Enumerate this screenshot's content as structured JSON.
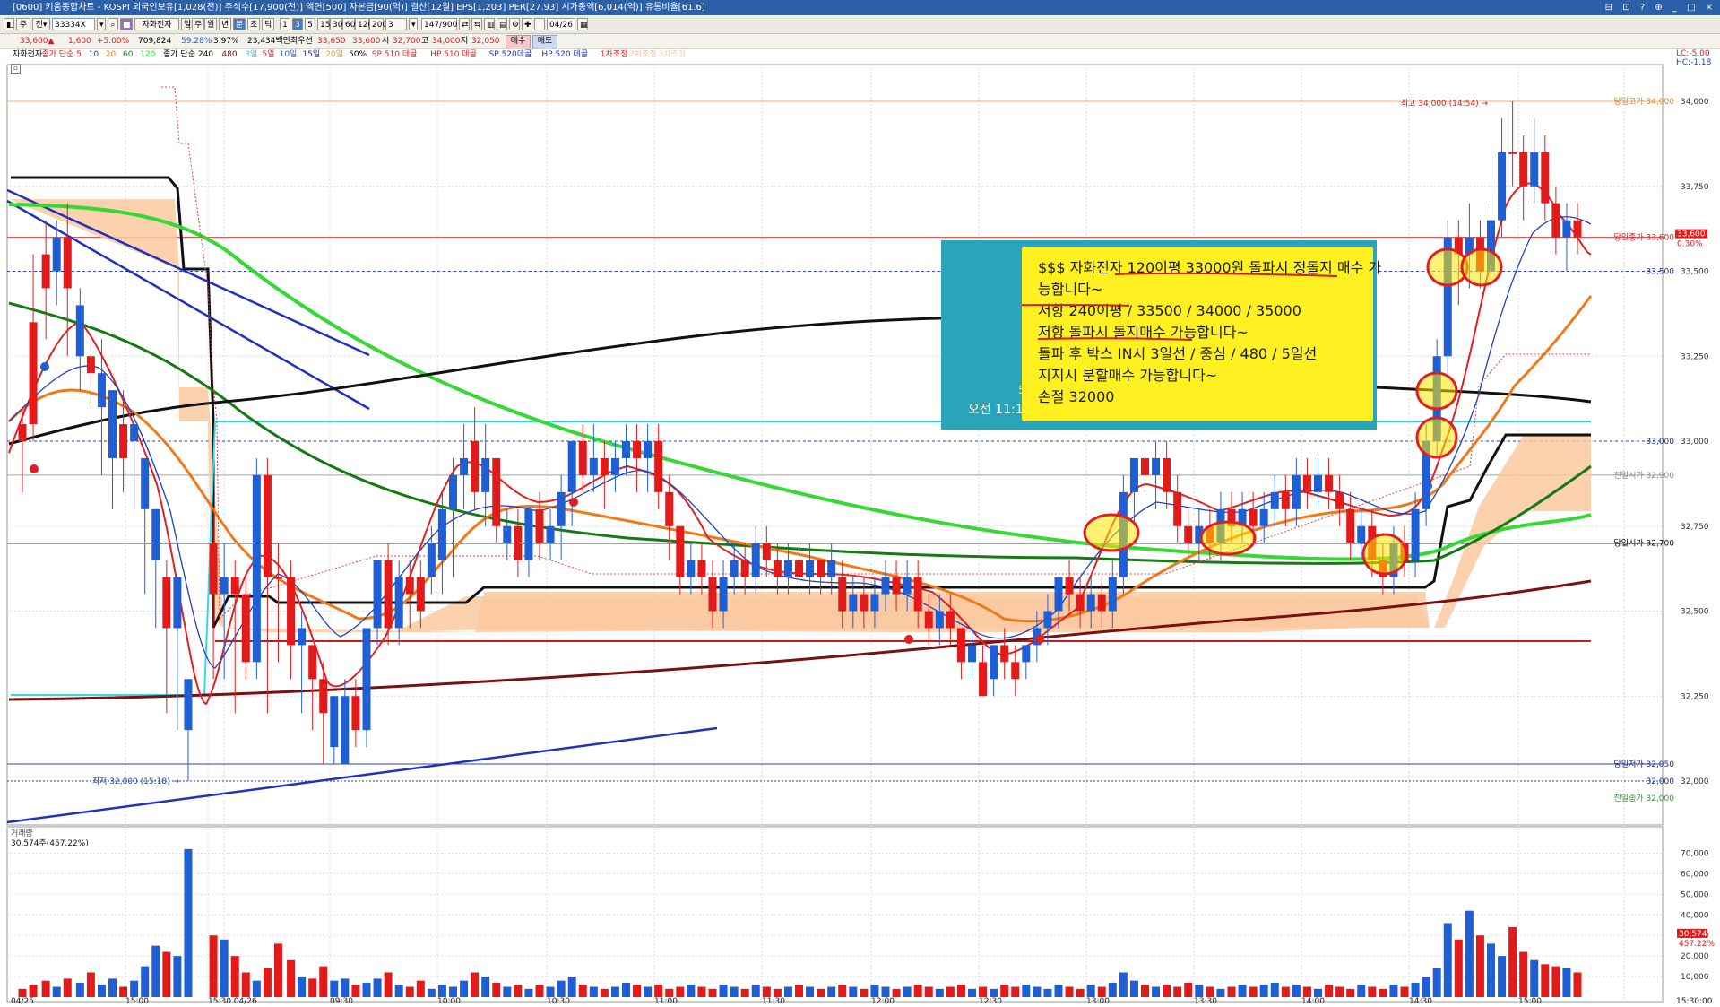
{
  "title_bar": {
    "text": "[0600] 키움종합차트 - KOSPI 외국인보유[1,028(천)] 주식수[17,900(천)] 액면[500] 자본금[90(억)] 결산[12월] EPS[1,203] PER[27.93] 시가총액[6,014(억)] 유통비율[61.6]",
    "controls": "⊟ ⊡ ? ⊕ _ □ ×"
  },
  "toolbar": {
    "code_value": "33334X",
    "stock_name": "자화전자",
    "period_buttons": [
      "일",
      "주",
      "월",
      "년",
      "분",
      "초",
      "틱"
    ],
    "minute_buttons": [
      "1",
      "3",
      "5",
      "15",
      "30",
      "60",
      "120",
      "200"
    ],
    "count": "3",
    "view_count": "147/900",
    "date": "04/26"
  },
  "quote": {
    "price": "33,600▲",
    "change": "1,600",
    "change_pct": "+5.00%",
    "volume": "709,824",
    "ratio": "59.28%",
    "pct2": "3.97%",
    "amount": "23,434백만",
    "best_ask_label": "최우선",
    "best_ask": "33,650",
    "best_bid": "33,600",
    "open_label": "시",
    "open": "32,700",
    "high_label": "고",
    "high": "34,000",
    "low_label": "저",
    "low": "32,050",
    "buy_button": "매수",
    "sell_button": "매도"
  },
  "legend": {
    "items": [
      {
        "text": "자화전자",
        "color": "#000000"
      },
      {
        "text": "종가 단순 5",
        "color": "#e02020"
      },
      {
        "text": "10",
        "color": "#1e3fbf"
      },
      {
        "text": "20",
        "color": "#f07a1a"
      },
      {
        "text": "60",
        "color": "#1a7a1a"
      },
      {
        "text": "120",
        "color": "#2ad42a"
      },
      {
        "text": "종가 단순 240",
        "color": "#000000"
      },
      {
        "text": "480",
        "color": "#7a1010"
      },
      {
        "text": "3일",
        "color": "#40c0d0"
      },
      {
        "text": "5일",
        "color": "#c03030"
      },
      {
        "text": "10일",
        "color": "#3060c0"
      },
      {
        "text": "15일",
        "color": "#303090"
      },
      {
        "text": "20일",
        "color": "#e0a040"
      },
      {
        "text": "50%",
        "color": "#000000"
      },
      {
        "text": "SP 510 데골",
        "color": "#e02020"
      },
      {
        "text": "HP 510 데골",
        "color": "#e02020"
      },
      {
        "text": "SP 520데골",
        "color": "#2030c0"
      },
      {
        "text": "HP 520 데골",
        "color": "#2030c0"
      },
      {
        "text": "1차조정",
        "color": "#e02020"
      },
      {
        "text": "2차조정",
        "color": "#f0c0a0"
      },
      {
        "text": "3차조정",
        "color": "#f0d0b0"
      }
    ],
    "corner_right": "LC:-5.00",
    "corner_right2": "HC:-1.18"
  },
  "price_axis": {
    "ticks": [
      "34,000",
      "33,750",
      "33,500",
      "33,250",
      "33,000",
      "32,750",
      "32,500",
      "32,250",
      "32,000"
    ],
    "labels": [
      {
        "text": "당일고가 34,000",
        "color": "#e08030"
      },
      {
        "text": "당일종가 33,600",
        "color": "#e02020"
      },
      {
        "text": "33,500",
        "color": "#1a2a9a"
      },
      {
        "text": "33,000",
        "color": "#1a2a9a"
      },
      {
        "text": "전일시가 32,900",
        "color": "#888888"
      },
      {
        "text": "당일시가 32,700",
        "color": "#000000"
      },
      {
        "text": "당일저가 32,050",
        "color": "#1a2a9a"
      },
      {
        "text": "32,000",
        "color": "#1a2a9a"
      },
      {
        "text": "전일종가 32,000",
        "color": "#2a9a2a"
      }
    ],
    "current_badge": "33,600",
    "current_badge2": "0.30%"
  },
  "time_axis": [
    "04/25",
    "15:00",
    "15:30 04/26",
    "09:30",
    "10:00",
    "10:30",
    "11:00",
    "11:30",
    "12:00",
    "12:30",
    "13:00",
    "13:30",
    "14:00",
    "14:30",
    "15:00",
    "15:30:00"
  ],
  "annotations": {
    "high_marker": "최고 34,000 (14:54) →",
    "low_marker": "최저 32,000 (15:18) →"
  },
  "note_overlay": {
    "time": "오전 11:13",
    "count": "5",
    "lines": [
      "$$$ 자화전자 120이평 33000원 돌파시 정돌지 매수 가",
      "능합니다~",
      "저항 240이평 / 33500 / 34000 / 35000",
      "저항 돌파시 돌지매수 가능합니다~",
      "돌파 후 박스 IN시 3일선 / 중심 / 480 / 5일선",
      "지지시 분할매수 가능합니다~",
      "손절 32000"
    ]
  },
  "volume_panel": {
    "title": "거래량",
    "value": "30,574주(457.22%)",
    "ticks": [
      "70,000",
      "60,000",
      "50,000",
      "40,000",
      "30,000",
      "20,000",
      "10,000"
    ],
    "badge": "30,574",
    "badge2": "457.22%"
  },
  "colors": {
    "up": "#e31a1a",
    "down": "#1f5fd6",
    "grid": "#d6d6d6",
    "box": "#fbc9a0"
  }
}
